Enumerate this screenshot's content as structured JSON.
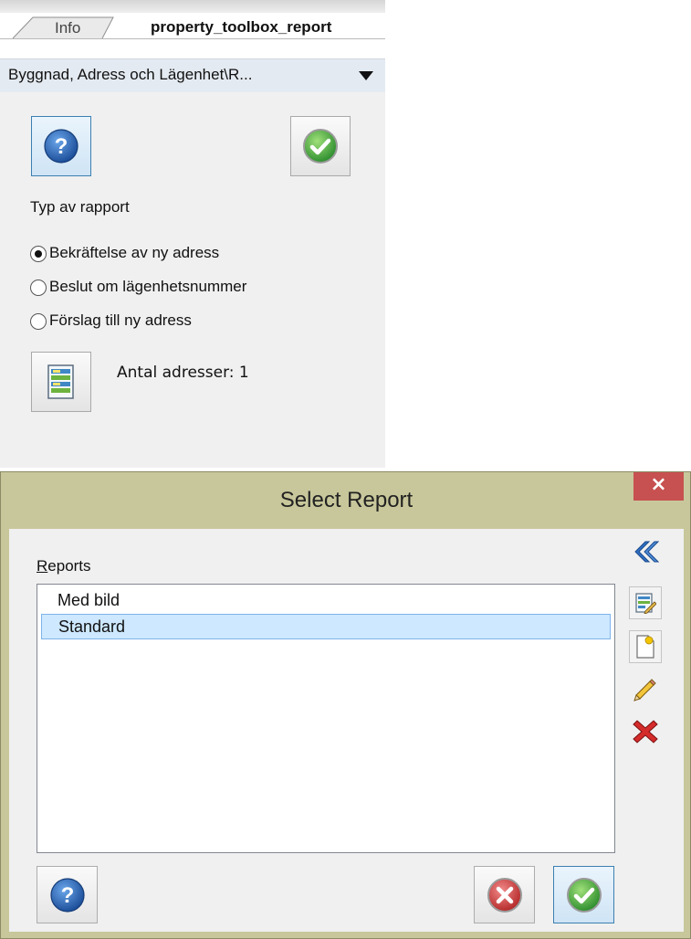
{
  "panel": {
    "tabs": [
      {
        "label": "Info"
      },
      {
        "label": "property_toolbox_report"
      }
    ],
    "combo_value": "Byggnad, Adress och Lägenhet\\R...",
    "report_type_label": "Typ av rapport",
    "options": [
      {
        "label": "Bekräftelse av ny adress",
        "checked": true
      },
      {
        "label": "Beslut om lägenhetsnummer",
        "checked": false
      },
      {
        "label": "Förslag till ny adress",
        "checked": false
      }
    ],
    "address_count_text": "Antal adresser: 1"
  },
  "dialog": {
    "title": "Select Report",
    "close_glyph": "×",
    "reports_label_mnemonic": "R",
    "reports_label_rest": "eports",
    "reports": [
      {
        "label": "Med bild",
        "selected": false
      },
      {
        "label": "Standard",
        "selected": true
      }
    ]
  },
  "colors": {
    "titlebar": "#c8c79b",
    "close_button": "#c75050",
    "selection": "#cde8ff",
    "ok_green": "#3ea43e",
    "cancel_red": "#d34b4b",
    "help_blue": "#2f6fc2"
  },
  "icons": {
    "help": "help-icon",
    "ok": "checkmark-icon",
    "cancel": "cancel-icon",
    "report": "report-icon",
    "collapse": "double-chevron-left-icon",
    "edit_report": "edit-report-icon",
    "new_report": "new-document-icon",
    "rename": "pencil-icon",
    "delete": "delete-icon"
  }
}
